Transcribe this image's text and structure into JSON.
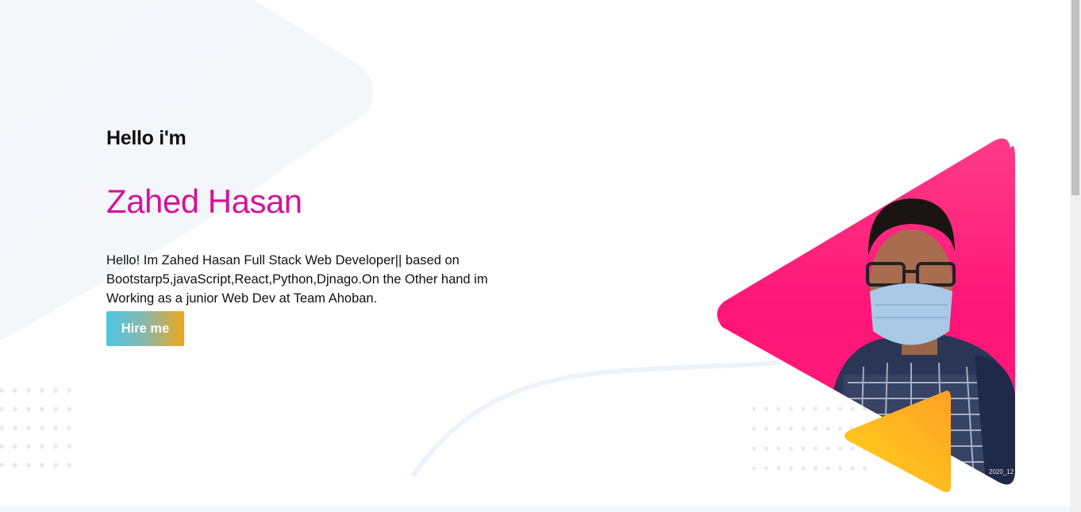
{
  "hero": {
    "greeting": "Hello i'm",
    "name": "Zahed Hasan",
    "intro": "Hello! Im Zahed Hasan Full Stack Web Developer|| based on Bootstarp5,javaScript,React,Python,Djnago.On the Other hand im Working as a junior Web Dev at Team Ahoban.",
    "hire_label": "Hire me"
  },
  "photo": {
    "timestamp": "2020_12"
  },
  "colors": {
    "name": "#d4139a",
    "triangle_pink": "#ff1f78",
    "triangle_yellow": "#ffc21a",
    "button_start": "#4ec5e6",
    "button_end": "#efa61b"
  },
  "icons": [
    "dot-grid",
    "play-triangle"
  ]
}
